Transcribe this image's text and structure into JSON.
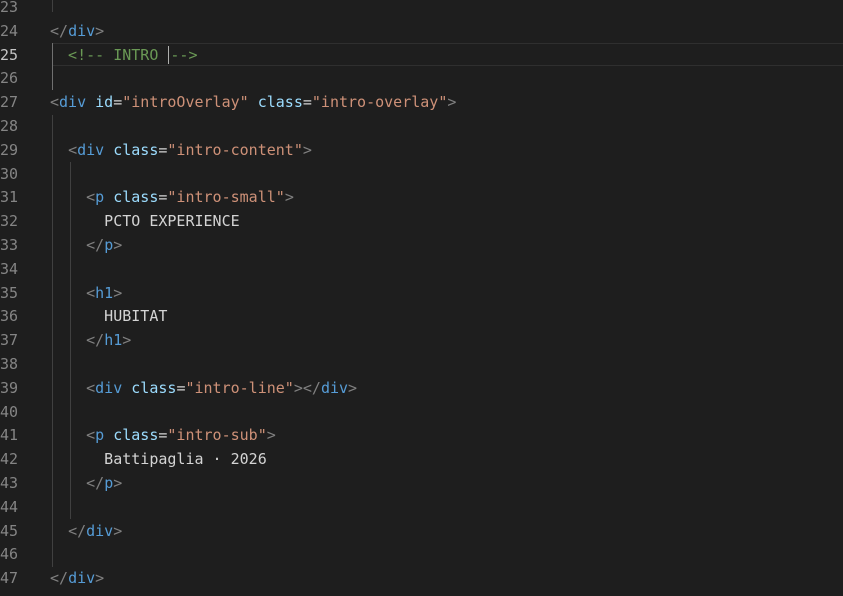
{
  "editor": {
    "active_line": "25",
    "lines": [
      {
        "num": "23",
        "tokens": []
      },
      {
        "num": "24",
        "tokens": [
          {
            "c": "t-bracket",
            "t": "</"
          },
          {
            "c": "t-tag",
            "t": "div"
          },
          {
            "c": "t-bracket",
            "t": ">"
          }
        ]
      },
      {
        "num": "25",
        "tokens": [
          {
            "c": "t-comment",
            "t": "  <!-- INTRO "
          },
          {
            "c": "cursor",
            "t": ""
          },
          {
            "c": "t-comment",
            "t": "-->"
          }
        ]
      },
      {
        "num": "26",
        "tokens": []
      },
      {
        "num": "27",
        "tokens": [
          {
            "c": "t-bracket",
            "t": "<"
          },
          {
            "c": "t-tag",
            "t": "div"
          },
          {
            "c": "t-text",
            "t": " "
          },
          {
            "c": "t-attr",
            "t": "id"
          },
          {
            "c": "t-eq",
            "t": "="
          },
          {
            "c": "t-str",
            "t": "\"introOverlay\""
          },
          {
            "c": "t-text",
            "t": " "
          },
          {
            "c": "t-attr",
            "t": "class"
          },
          {
            "c": "t-eq",
            "t": "="
          },
          {
            "c": "t-str",
            "t": "\"intro-overlay\""
          },
          {
            "c": "t-bracket",
            "t": ">"
          }
        ]
      },
      {
        "num": "28",
        "tokens": []
      },
      {
        "num": "29",
        "tokens": [
          {
            "c": "t-text",
            "t": "  "
          },
          {
            "c": "t-bracket",
            "t": "<"
          },
          {
            "c": "t-tag",
            "t": "div"
          },
          {
            "c": "t-text",
            "t": " "
          },
          {
            "c": "t-attr",
            "t": "class"
          },
          {
            "c": "t-eq",
            "t": "="
          },
          {
            "c": "t-str",
            "t": "\"intro-content\""
          },
          {
            "c": "t-bracket",
            "t": ">"
          }
        ]
      },
      {
        "num": "30",
        "tokens": []
      },
      {
        "num": "31",
        "tokens": [
          {
            "c": "t-text",
            "t": "    "
          },
          {
            "c": "t-bracket",
            "t": "<"
          },
          {
            "c": "t-tag",
            "t": "p"
          },
          {
            "c": "t-text",
            "t": " "
          },
          {
            "c": "t-attr",
            "t": "class"
          },
          {
            "c": "t-eq",
            "t": "="
          },
          {
            "c": "t-str",
            "t": "\"intro-small\""
          },
          {
            "c": "t-bracket",
            "t": ">"
          }
        ]
      },
      {
        "num": "32",
        "tokens": [
          {
            "c": "t-text",
            "t": "      PCTO EXPERIENCE"
          }
        ]
      },
      {
        "num": "33",
        "tokens": [
          {
            "c": "t-text",
            "t": "    "
          },
          {
            "c": "t-bracket",
            "t": "</"
          },
          {
            "c": "t-tag",
            "t": "p"
          },
          {
            "c": "t-bracket",
            "t": ">"
          }
        ]
      },
      {
        "num": "34",
        "tokens": []
      },
      {
        "num": "35",
        "tokens": [
          {
            "c": "t-text",
            "t": "    "
          },
          {
            "c": "t-bracket",
            "t": "<"
          },
          {
            "c": "t-tag",
            "t": "h1"
          },
          {
            "c": "t-bracket",
            "t": ">"
          }
        ]
      },
      {
        "num": "36",
        "tokens": [
          {
            "c": "t-text",
            "t": "      HUBITAT"
          }
        ]
      },
      {
        "num": "37",
        "tokens": [
          {
            "c": "t-text",
            "t": "    "
          },
          {
            "c": "t-bracket",
            "t": "</"
          },
          {
            "c": "t-tag",
            "t": "h1"
          },
          {
            "c": "t-bracket",
            "t": ">"
          }
        ]
      },
      {
        "num": "38",
        "tokens": []
      },
      {
        "num": "39",
        "tokens": [
          {
            "c": "t-text",
            "t": "    "
          },
          {
            "c": "t-bracket",
            "t": "<"
          },
          {
            "c": "t-tag",
            "t": "div"
          },
          {
            "c": "t-text",
            "t": " "
          },
          {
            "c": "t-attr",
            "t": "class"
          },
          {
            "c": "t-eq",
            "t": "="
          },
          {
            "c": "t-str",
            "t": "\"intro-line\""
          },
          {
            "c": "t-bracket",
            "t": "></"
          },
          {
            "c": "t-tag",
            "t": "div"
          },
          {
            "c": "t-bracket",
            "t": ">"
          }
        ]
      },
      {
        "num": "40",
        "tokens": []
      },
      {
        "num": "41",
        "tokens": [
          {
            "c": "t-text",
            "t": "    "
          },
          {
            "c": "t-bracket",
            "t": "<"
          },
          {
            "c": "t-tag",
            "t": "p"
          },
          {
            "c": "t-text",
            "t": " "
          },
          {
            "c": "t-attr",
            "t": "class"
          },
          {
            "c": "t-eq",
            "t": "="
          },
          {
            "c": "t-str",
            "t": "\"intro-sub\""
          },
          {
            "c": "t-bracket",
            "t": ">"
          }
        ]
      },
      {
        "num": "42",
        "tokens": [
          {
            "c": "t-text",
            "t": "      Battipaglia · 2026"
          }
        ]
      },
      {
        "num": "43",
        "tokens": [
          {
            "c": "t-text",
            "t": "    "
          },
          {
            "c": "t-bracket",
            "t": "</"
          },
          {
            "c": "t-tag",
            "t": "p"
          },
          {
            "c": "t-bracket",
            "t": ">"
          }
        ]
      },
      {
        "num": "44",
        "tokens": []
      },
      {
        "num": "45",
        "tokens": [
          {
            "c": "t-text",
            "t": "  "
          },
          {
            "c": "t-bracket",
            "t": "</"
          },
          {
            "c": "t-tag",
            "t": "div"
          },
          {
            "c": "t-bracket",
            "t": ">"
          }
        ]
      },
      {
        "num": "46",
        "tokens": []
      },
      {
        "num": "47",
        "tokens": [
          {
            "c": "t-bracket",
            "t": "</"
          },
          {
            "c": "t-tag",
            "t": "div"
          },
          {
            "c": "t-bracket",
            "t": ">"
          }
        ]
      }
    ]
  }
}
